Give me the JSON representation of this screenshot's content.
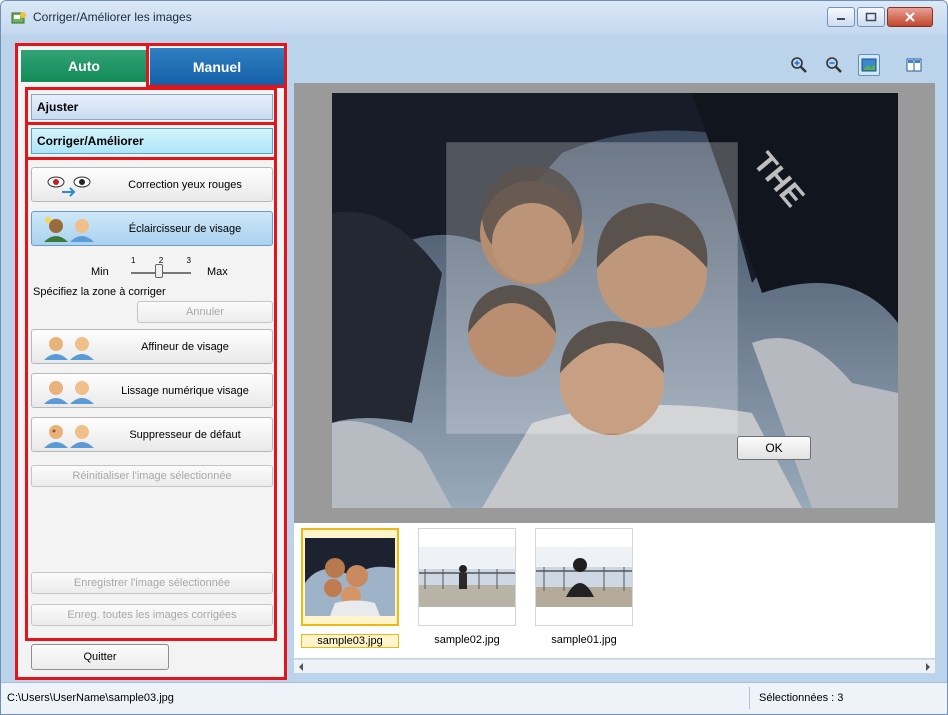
{
  "window": {
    "title": "Corriger/Améliorer les images",
    "accent": "#e4141b"
  },
  "tabs": [
    {
      "label": "Auto",
      "selected": false,
      "color": "#138a58"
    },
    {
      "label": "Manuel",
      "selected": true,
      "color": "#155fa6"
    }
  ],
  "sections": {
    "adjust": "Ajuster",
    "correct": "Corriger/Améliorer"
  },
  "tools": {
    "red_eye": "Correction yeux rouges",
    "face_brightener": "Éclaircisseur de visage",
    "face_sharpener": "Affineur de visage",
    "digital_face_smoothing": "Lissage numérique visage",
    "blemish_remover": "Suppresseur de défaut"
  },
  "slider": {
    "min_label": "Min",
    "max_label": "Max",
    "ticks": [
      "1",
      "2",
      "3"
    ],
    "value": 2
  },
  "hint": "Spécifiez la zone à corriger",
  "buttons": {
    "cancel": "Annuler",
    "reset": "Réinitialiser l'image sélectionnée",
    "save_selected": "Enregistrer l'image sélectionnée",
    "save_all": "Enreg. toutes les images corrigées",
    "quit": "Quitter",
    "ok": "OK"
  },
  "thumbnails": [
    {
      "name": "sample03.jpg",
      "selected": true
    },
    {
      "name": "sample02.jpg",
      "selected": false
    },
    {
      "name": "sample01.jpg",
      "selected": false
    }
  ],
  "status": {
    "path": "C:\\Users\\UserName\\sample03.jpg",
    "selected": "Sélectionnées : 3"
  },
  "toolbar_icons": [
    "zoom-in-icon",
    "zoom-out-icon",
    "full-image-icon",
    "compare-icon"
  ]
}
